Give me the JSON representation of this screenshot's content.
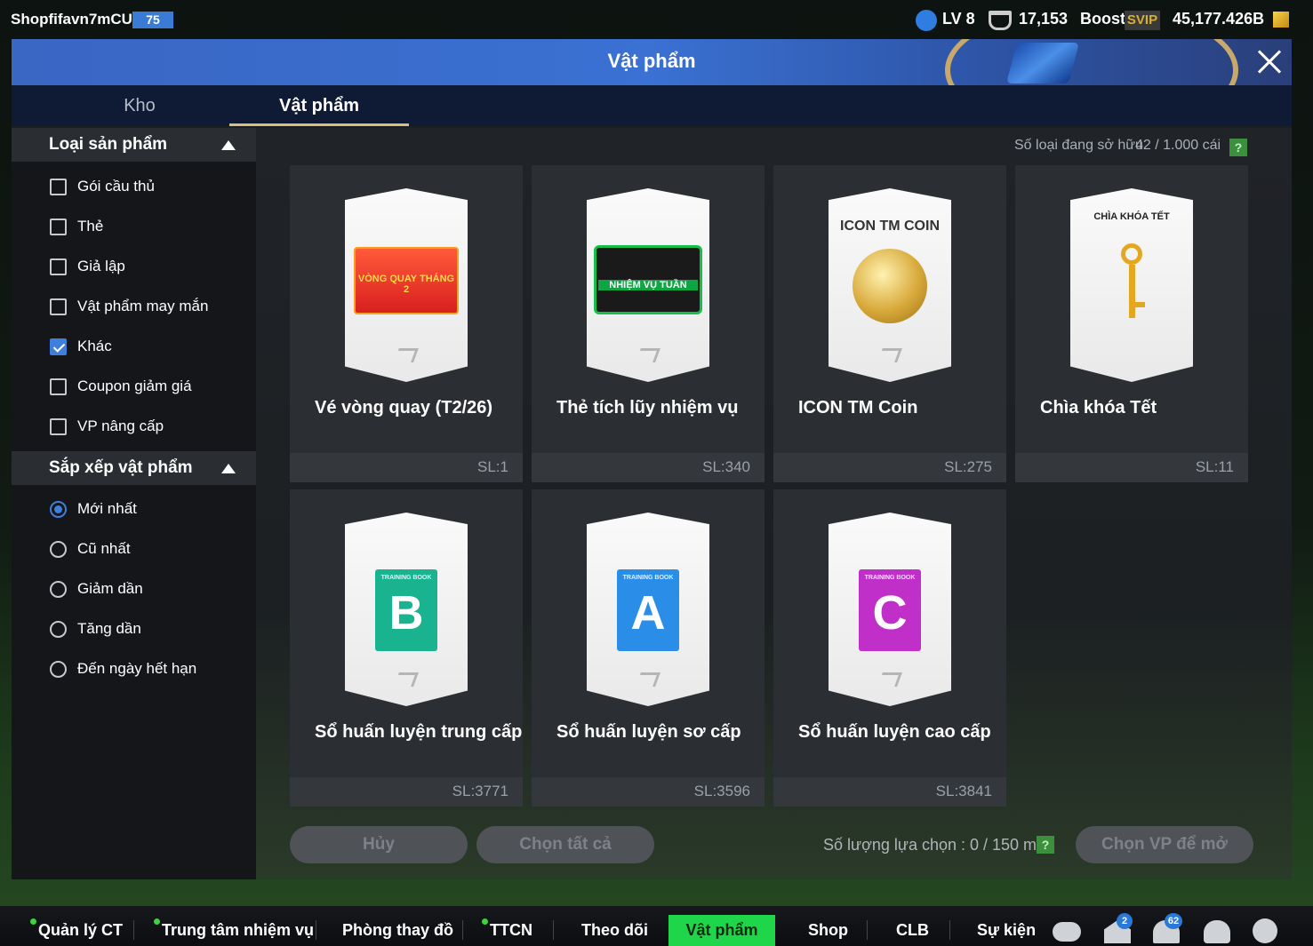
{
  "top": {
    "username": "Shopfifavn7mCU",
    "user_badge": "75",
    "level": "LV 8",
    "points": "17,153",
    "boost": "Boost",
    "svip": "SVIP",
    "currency": "45,177.426B"
  },
  "window": {
    "title": "Vật phẩm"
  },
  "tabs": [
    {
      "label": "Kho"
    },
    {
      "label": "Vật phẩm"
    }
  ],
  "filter": {
    "title": "Loại sản phẩm",
    "options": [
      {
        "label": "Gói cầu thủ",
        "checked": false
      },
      {
        "label": "Thẻ",
        "checked": false
      },
      {
        "label": "Giả lập",
        "checked": false
      },
      {
        "label": "Vật phẩm may mắn",
        "checked": false
      },
      {
        "label": "Khác",
        "checked": true
      },
      {
        "label": "Coupon giảm giá",
        "checked": false
      },
      {
        "label": "VP nâng cấp",
        "checked": false
      }
    ]
  },
  "sort": {
    "title": "Sắp xếp vật phẩm",
    "options": [
      {
        "label": "Mới nhất",
        "selected": true
      },
      {
        "label": "Cũ nhất",
        "selected": false
      },
      {
        "label": "Giảm dần",
        "selected": false
      },
      {
        "label": "Tăng dần",
        "selected": false
      },
      {
        "label": "Đến ngày hết hạn",
        "selected": false
      }
    ]
  },
  "owned": {
    "label": "Số loại đang sở hữu",
    "value": "42 / 1.000 cái",
    "help": "?"
  },
  "items": [
    {
      "name": "Vé vòng quay (T2/26)",
      "qty": "SL:1",
      "art": "voucher",
      "art_text": "VÒNG QUAY THÁNG 2"
    },
    {
      "name": "Thẻ tích lũy nhiệm vụ",
      "qty": "SL:340",
      "art": "mission",
      "art_text": "NHIỆM VỤ TUẦN"
    },
    {
      "name": "ICON TM Coin",
      "qty": "SL:275",
      "art": "coin",
      "art_text": "ICON TM COIN"
    },
    {
      "name": "Chìa khóa Tết",
      "qty": "SL:11",
      "art": "key",
      "art_text": "CHÌA KHÓA TẾT"
    },
    {
      "name": "Sổ huấn luyện trung cấp",
      "qty": "SL:3771",
      "art": "book",
      "art_text": "TRAINING BOOK",
      "letter": "B",
      "color": "#19b38f"
    },
    {
      "name": "Sổ huấn luyện sơ cấp",
      "qty": "SL:3596",
      "art": "book",
      "art_text": "TRAINING BOOK",
      "letter": "A",
      "color": "#2a8ee8"
    },
    {
      "name": "Sổ huấn luyện cao cấp",
      "qty": "SL:3841",
      "art": "book",
      "art_text": "TRAINING BOOK",
      "letter": "C",
      "color": "#c12fc9"
    }
  ],
  "actions": {
    "cancel": "Hủy",
    "select_all": "Chọn tất cả",
    "selection_label": "Số lượng lựa chọn : 0 / 150 món",
    "help": "?",
    "open": "Chọn VP để mở"
  },
  "nav": [
    {
      "label": "Quản lý CT",
      "dot": true
    },
    {
      "label": "Trung tâm nhiệm vụ",
      "dot": true
    },
    {
      "label": "Phòng thay đồ",
      "dot": false
    },
    {
      "label": "TTCN",
      "dot": true
    },
    {
      "label": "Theo dõi",
      "dot": false
    },
    {
      "label": "Vật phẩm",
      "dot": false,
      "active": true
    },
    {
      "label": "Shop",
      "dot": false
    },
    {
      "label": "CLB",
      "dot": false
    },
    {
      "label": "Sự kiện",
      "dot": false
    }
  ],
  "nav_badges": {
    "mail": "2",
    "notifications": "62"
  },
  "colors": {
    "accent_green": "#1fd64a",
    "select_blue": "#3f7fdb",
    "header_blue": "#3a71d2"
  },
  "icons": [
    "chat-icon",
    "mail-icon",
    "bell-icon",
    "profile-icon",
    "gear-icon",
    "close-icon",
    "face-icon",
    "shield-icon",
    "gold-icon"
  ]
}
